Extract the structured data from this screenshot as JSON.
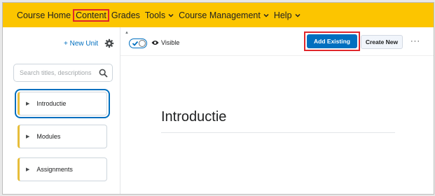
{
  "navbar": {
    "items": [
      {
        "label": "Course Home"
      },
      {
        "label": "Content"
      },
      {
        "label": "Grades"
      },
      {
        "label": "Tools"
      },
      {
        "label": "Course Management"
      },
      {
        "label": "Help"
      }
    ]
  },
  "sidebar": {
    "new_unit_label": "+ New Unit",
    "search_placeholder": "Search titles, descriptions",
    "units": [
      {
        "label": "Introductie"
      },
      {
        "label": "Modules"
      },
      {
        "label": "Assignments"
      }
    ]
  },
  "toolbar": {
    "visibility_label": "Visible",
    "add_existing_label": "Add Existing",
    "create_new_label": "Create New",
    "more_label": "···"
  },
  "main": {
    "title": "Introductie"
  },
  "colors": {
    "navbar_bg": "#fcc500",
    "primary": "#006fbf",
    "highlight_border": "#e0262b",
    "unit_accent": "#e7bd3a"
  }
}
